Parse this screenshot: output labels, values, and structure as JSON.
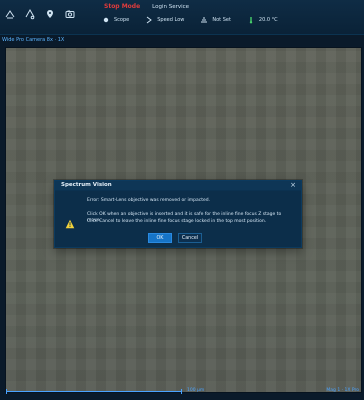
{
  "toolbar": {
    "icons": [
      "stage-home-icon",
      "objective-icon",
      "pin-icon",
      "camera-icon"
    ],
    "mode": {
      "title": "Stop Mode",
      "subtitle": "Login Service"
    },
    "status": [
      {
        "icon": "scope-icon",
        "label": "Scope"
      },
      {
        "icon": "speed-icon",
        "label": "Speed Low"
      },
      {
        "icon": "not-set-icon",
        "label": "Not Set"
      },
      {
        "icon": "temperature-icon",
        "label": "20.0 °C"
      }
    ]
  },
  "camera": {
    "label": "Wide Pro Camera  8x  · 1X"
  },
  "viewport": {
    "scale_label": "100 µm",
    "corner_label": "Mag 1 · 1X Pro"
  },
  "dialog": {
    "title": "Spectrum Vision",
    "lines": [
      "Error: Smart-Lens objective was removed or impacted.",
      "Click OK when an objective is inserted and it is safe for the inline fine focus Z stage to move.",
      "Click Cancel to leave the inline fine focus stage locked in the top most position."
    ],
    "ok_label": "OK",
    "cancel_label": "Cancel"
  },
  "colors": {
    "mode_red": "#e13b3b",
    "accent_blue": "#1674c7",
    "warning_yellow": "#f2d23b",
    "temp_green": "#47d06b"
  }
}
